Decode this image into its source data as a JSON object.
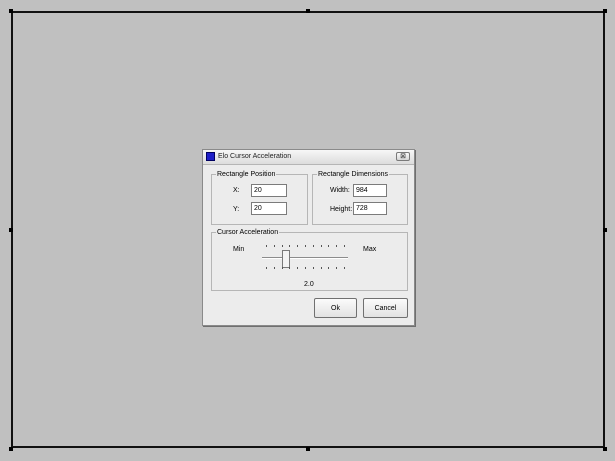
{
  "dialog": {
    "title": "Elo Cursor Acceleration",
    "close_glyph": "⊠"
  },
  "rectangle_position": {
    "legend": "Rectangle Position",
    "x_label": "X:",
    "x_value": "20",
    "y_label": "Y:",
    "y_value": "20"
  },
  "rectangle_dimensions": {
    "legend": "Rectangle Dimensions",
    "width_label": "Width:",
    "width_value": "984",
    "height_label": "Height:",
    "height_value": "728"
  },
  "cursor_acceleration": {
    "legend": "Cursor Acceleration",
    "min_label": "Min",
    "max_label": "Max",
    "value_text": "2.0",
    "slider_level": 0.25
  },
  "buttons": {
    "ok": "Ok",
    "cancel": "Cancel"
  },
  "colors": {
    "background": "#c0c0c0",
    "dialog": "#ececec",
    "app_icon": "#1e1ec8"
  }
}
